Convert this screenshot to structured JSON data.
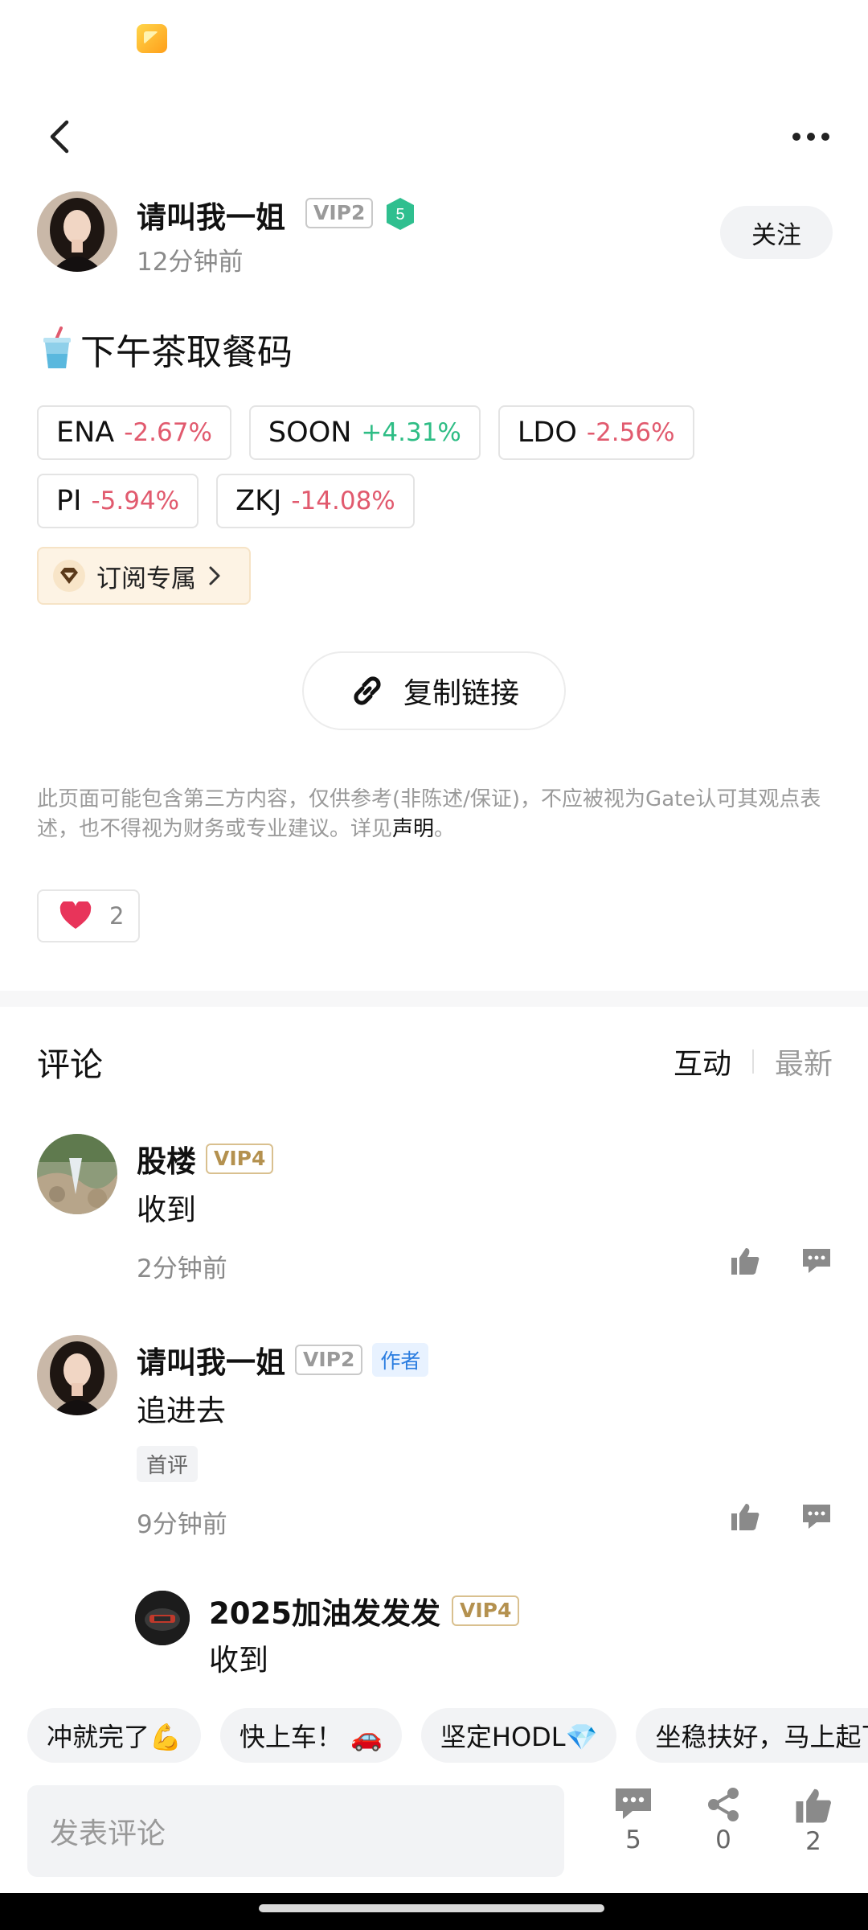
{
  "post": {
    "author_name": "请叫我一姐",
    "author_vip": "VIP2",
    "author_level": "5",
    "time": "12分钟前",
    "follow_label": "关注",
    "title": "下午茶取餐码",
    "tickers": [
      {
        "symbol": "ENA",
        "change": "-2.67%",
        "direction": "down"
      },
      {
        "symbol": "SOON",
        "change": "+4.31%",
        "direction": "up"
      },
      {
        "symbol": "LDO",
        "change": "-2.56%",
        "direction": "down"
      },
      {
        "symbol": "PI",
        "change": "-5.94%",
        "direction": "down"
      },
      {
        "symbol": "ZKJ",
        "change": "-14.08%",
        "direction": "down"
      }
    ],
    "subscribe_label": "订阅专属",
    "copy_link_label": "复制链接",
    "disclaimer_text": "此页面可能包含第三方内容，仅供参考(非陈述/保证)，不应被视为Gate认可其观点表述，也不得视为财务或专业建议。详见",
    "disclaimer_link": "声明",
    "disclaimer_end": "。",
    "like_count": "2"
  },
  "comments_section": {
    "title": "评论",
    "sort_active": "互动",
    "sort_inactive": "最新",
    "comments": [
      {
        "name": "股楼",
        "vip": "VIP4",
        "text": "收到",
        "time": "2分钟前"
      },
      {
        "name": "请叫我一姐",
        "vip": "VIP2",
        "author_tag": "作者",
        "text": "追进去",
        "tag": "首评",
        "time": "9分钟前"
      }
    ],
    "reply": {
      "name": "2025加油发发发",
      "vip": "VIP4",
      "text": "收到"
    }
  },
  "quick_replies": [
    "冲就完了💪",
    "快上车！ 🚗",
    "坚定HODL💎",
    "坐稳扶好，马上起飞"
  ],
  "bottom_bar": {
    "input_placeholder": "发表评论",
    "comment_count": "5",
    "share_count": "0",
    "like_count": "2"
  },
  "colors": {
    "up": "#2ebd85",
    "down": "#e15a6e",
    "author_tag": "#2b7de0"
  }
}
